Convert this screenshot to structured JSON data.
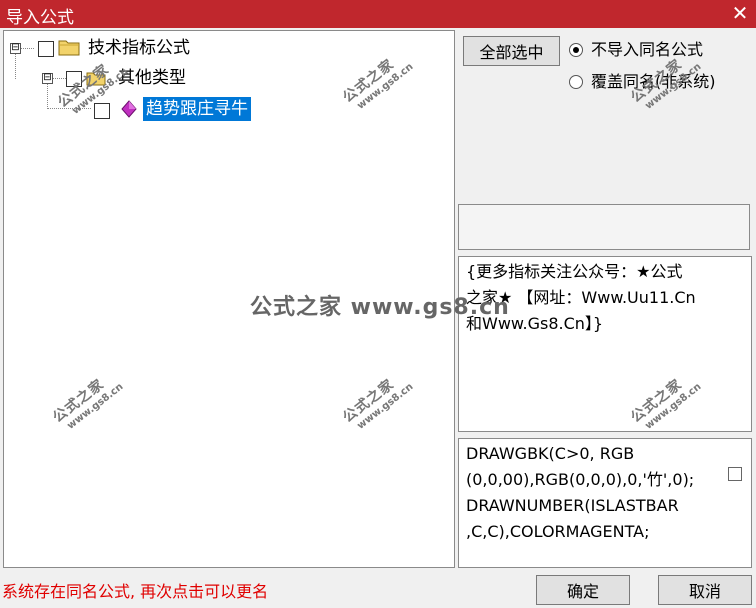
{
  "window": {
    "title": "导入公式",
    "close_glyph": "✕"
  },
  "tree": {
    "root": {
      "label": "技术指标公式",
      "expander": "⊟"
    },
    "group": {
      "label": "其他类型",
      "expander": "⊟"
    },
    "item": {
      "label": "趋势跟庄寻牛"
    }
  },
  "controls": {
    "select_all_label": "全部选中",
    "options": [
      {
        "label": "不导入同名公式",
        "selected": true
      },
      {
        "label": "覆盖同名(非系统)",
        "selected": false
      }
    ]
  },
  "description": {
    "lines": [
      "{更多指标关注公众号：★公式",
      "之家★ 【网址：Www.Uu11.Cn",
      "和Www.Gs8.Cn】}"
    ]
  },
  "code": {
    "lines": [
      "DRAWGBK(C>0, RGB",
      "(0,0,00),RGB(0,0,0),0,'竹',0);",
      "DRAWNUMBER(ISLASTBAR",
      ",C,C),COLORMAGENTA;"
    ]
  },
  "status": {
    "text": "系统存在同名公式, 再次点击可以更名"
  },
  "footer": {
    "ok_label": "确定",
    "cancel_label": "取消"
  },
  "watermark": {
    "small_title": "公式之家",
    "small_url": "www.gs8.cn",
    "center_text": "公式之家 www.gs8.cn"
  },
  "colors": {
    "title_bar": "#c0272d",
    "selection": "#0078d7",
    "status_text": "#e00000"
  }
}
